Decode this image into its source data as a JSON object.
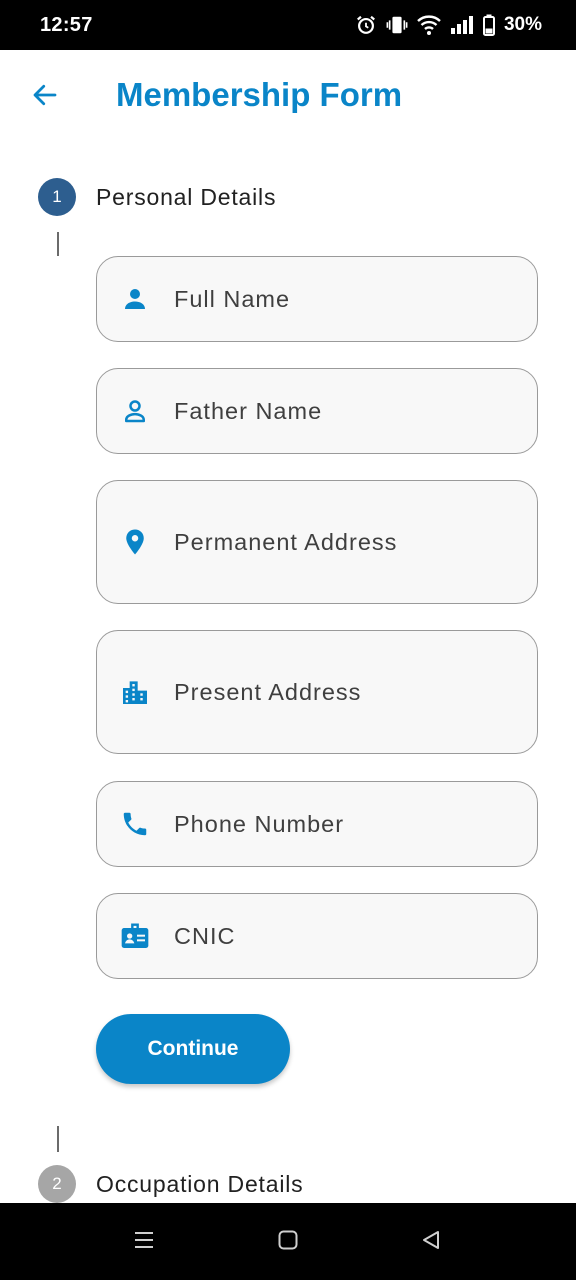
{
  "status_bar": {
    "time": "12:57",
    "battery": "30%",
    "icons": [
      "alarm-icon",
      "vibrate-icon",
      "wifi-icon",
      "signal-icon",
      "battery-icon"
    ]
  },
  "app_bar": {
    "title": "Membership Form",
    "back_icon": "arrow-back-icon"
  },
  "colors": {
    "accent": "#0a85c8",
    "step_active": "#2d5e8f",
    "step_inactive": "#a6a6a6",
    "field_border": "#9a9a9a",
    "field_bg": "#f8f8f8"
  },
  "steps": [
    {
      "number": "1",
      "label": "Personal Details",
      "state": "active"
    },
    {
      "number": "2",
      "label": "Occupation Details",
      "state": "inactive"
    }
  ],
  "fields": [
    {
      "label": "Full Name",
      "icon": "person-icon"
    },
    {
      "label": "Father Name",
      "icon": "person-outline-icon"
    },
    {
      "label": "Permanent Address",
      "icon": "location-pin-icon"
    },
    {
      "label": "Present Address",
      "icon": "building-icon"
    },
    {
      "label": "Phone Number",
      "icon": "phone-icon"
    },
    {
      "label": "CNIC",
      "icon": "id-badge-icon"
    }
  ],
  "continue_label": "Continue",
  "nav_bar": {
    "icons": [
      "recents-menu-icon",
      "home-square-icon",
      "back-triangle-icon"
    ]
  }
}
